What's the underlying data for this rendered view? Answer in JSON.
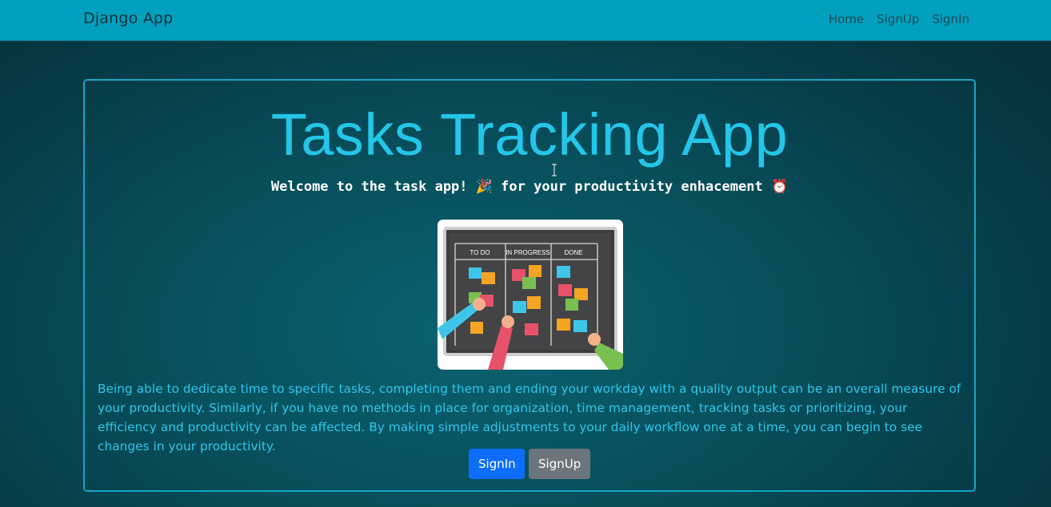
{
  "navbar": {
    "brand": "Django App",
    "links": [
      "Home",
      "SignUp",
      "SignIn"
    ]
  },
  "hero": {
    "title": "Tasks Tracking App",
    "subtitle_part1": "Welcome to the task app! ",
    "subtitle_icon1": "🎉",
    "subtitle_part2": " for your productivity enhacement ",
    "subtitle_icon2": "⏰",
    "image": {
      "columns": [
        "TO DO",
        "IN PROGRESS",
        "DONE"
      ]
    },
    "description": "Being able to dedicate time to specific tasks, completing them and ending your workday with a quality output can be an overall measure of your productivity. Similarly, if you have no methods in place for organization, time management, tracking tasks or prioritizing, your efficiency and productivity can be affected. By making simple adjustments to your daily workflow one at a time, you can begin to see changes in your productivity.",
    "buttons": {
      "signin": "SignIn",
      "signup": "SignUp"
    }
  },
  "colors": {
    "navbar": "#01a0bf",
    "title": "#23c6e8",
    "primary_button": "#0d6efd",
    "secondary_button": "#6c757d"
  },
  "icons": [
    "party-popper-icon",
    "alarm-clock-icon",
    "text-cursor-icon"
  ]
}
